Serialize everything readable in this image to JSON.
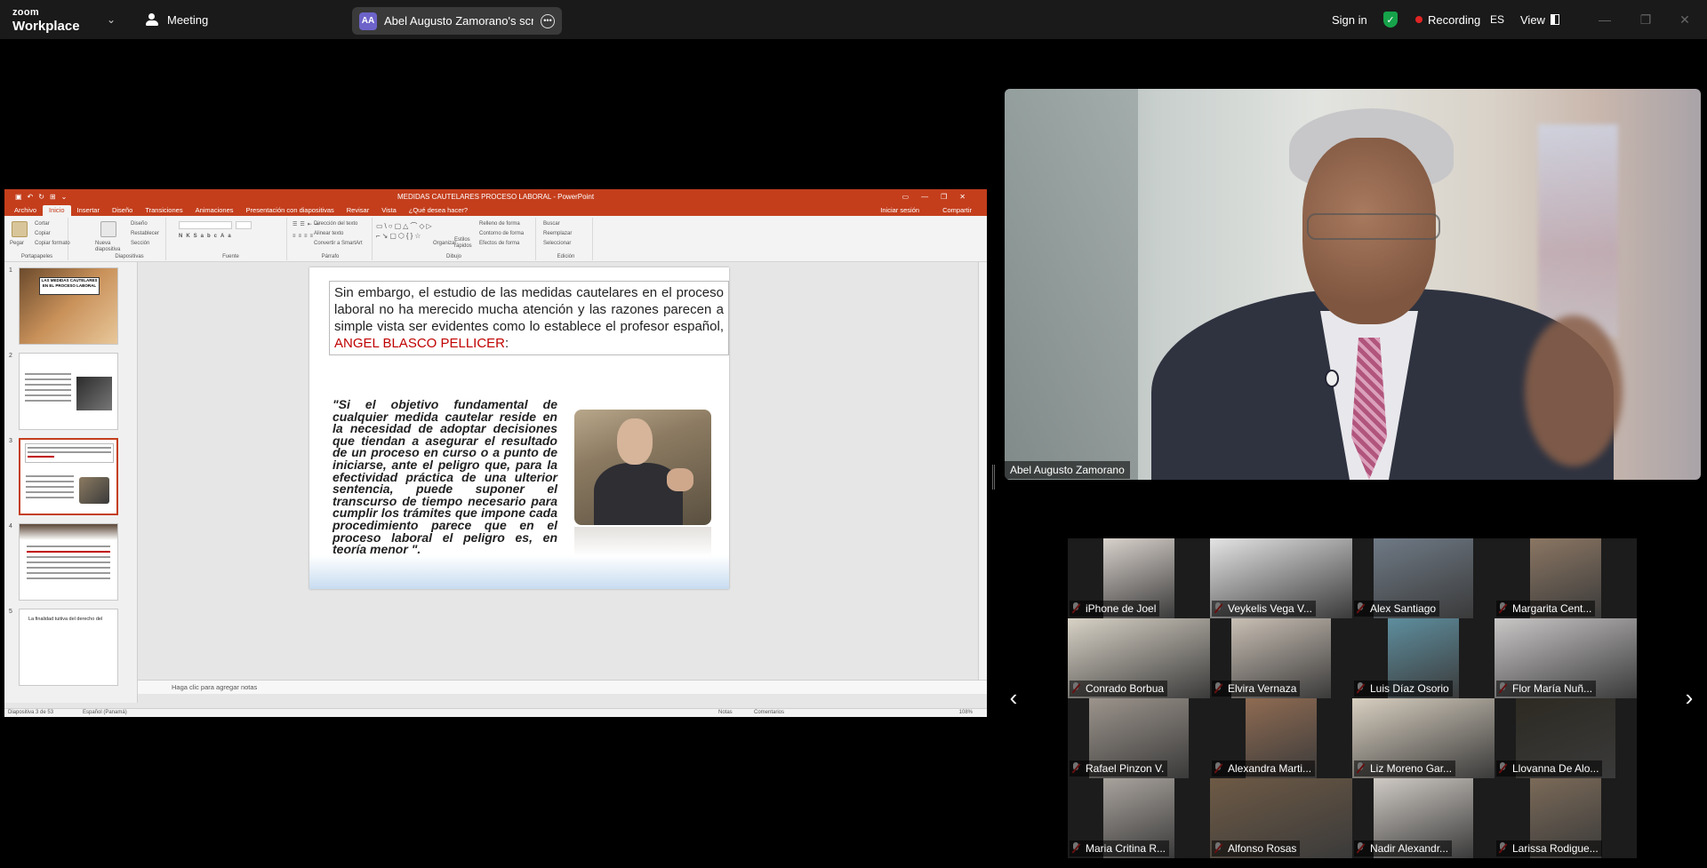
{
  "topbar": {
    "brand_small": "zoom",
    "brand_big": "Workplace",
    "meeting_label": "Meeting",
    "share_avatar": "AA",
    "share_label": "Abel Augusto Zamorano's screen",
    "signin_label": "Sign in",
    "recording_label": "Recording",
    "lang_label": "ES",
    "view_label": "View",
    "accent_recording": "#e02424",
    "accent_shield": "#16a34a"
  },
  "ppt": {
    "title": "MEDIDAS CAUTELARES PROCESO LABORAL - PowerPoint",
    "tabs": [
      "Archivo",
      "Inicio",
      "Insertar",
      "Diseño",
      "Transiciones",
      "Animaciones",
      "Presentación con diapositivas",
      "Revisar",
      "Vista",
      "¿Qué desea hacer?"
    ],
    "active_tab": "Inicio",
    "tabs_right": [
      "Iniciar sesión",
      "Compartir"
    ],
    "ribbon": {
      "portapapeles": "Portapapeles",
      "pegar": "Pegar",
      "cortar": "Cortar",
      "copiar": "Copiar",
      "copiar_formato": "Copiar formato",
      "nueva_diapositiva": "Nueva diapositiva",
      "diseno": "Diseño",
      "restablecer": "Restablecer",
      "seccion": "Sección",
      "diapositivas": "Diapositivas",
      "fuente": "Fuente",
      "parrafo": "Párrafo",
      "direccion_texto": "Dirección del texto",
      "alinear_texto": "Alinear texto",
      "convertir_smartart": "Convertir a SmartArt",
      "organizar": "Organizar",
      "estilos_rapidos": "Estilos rápidos",
      "relleno_forma": "Relleno de forma",
      "contorno_forma": "Contorno de forma",
      "efectos_forma": "Efectos de forma",
      "dibujo": "Dibujo",
      "buscar": "Buscar",
      "reemplazar": "Reemplazar",
      "seleccionar": "Seleccionar",
      "edicion": "Edición"
    },
    "thumbnails": [
      {
        "num": "1",
        "title": "LAS MEDIDAS CAUTELARES EN EL PROCESO LABORAL"
      },
      {
        "num": "2"
      },
      {
        "num": "3"
      },
      {
        "num": "4"
      },
      {
        "num": "5",
        "snippet": "La finalidad tuitiva del derecho del"
      }
    ],
    "slide": {
      "intro": "Sin embargo, el estudio de las medidas cautelares en el proceso laboral no ha merecido mucha atención y las razones parecen a simple vista ser evidentes como lo establece el profesor español, ",
      "author": "ANGEL BLASCO PELLICER",
      "colon": ":",
      "quote": "\"Si el objetivo fundamental de cualquier medida cautelar reside en la necesidad de adoptar decisiones que tiendan a asegurar el resultado de un proceso en curso o a punto de iniciarse, ante el peligro que, para la efectividad práctica de una ulterior sentencia, puede suponer el transcurso de tiempo necesario para cumplir los trámites que impone cada procedimiento parece que en el proceso laboral el peligro es, en teoría menor \".",
      "author_color": "#c00000"
    },
    "notes_placeholder": "Haga clic para agregar notas",
    "status": {
      "slide_count": "Diapositiva 3 de 53",
      "language": "Español (Panamá)",
      "notas": "Notas",
      "comentarios": "Comentarios",
      "zoom": "108%"
    }
  },
  "speaker": {
    "name": "Abel Augusto Zamorano"
  },
  "gallery": {
    "participants": [
      {
        "name": "iPhone de Joel",
        "bg": "#1c1c1c",
        "photo": "#d9d2cc"
      },
      {
        "name": "Veykelis Vega V...",
        "bg": "#1c1c1c",
        "photo": "#e4e4e4"
      },
      {
        "name": "Alex Santiago",
        "bg": "#1c1c1c",
        "photo": "#6f7a86"
      },
      {
        "name": "Margarita Cent...",
        "bg": "#1c1c1c",
        "photo": "#8b7663"
      },
      {
        "name": "Conrado Borbua",
        "bg": "#1c1c1c",
        "photo": "#d8d2c6"
      },
      {
        "name": "Elvira Vernaza",
        "bg": "#1c1c1c",
        "photo": "#c9bfb4"
      },
      {
        "name": "Luis Díaz Osorio",
        "bg": "#1c1c1c",
        "photo": "#5e8e9e"
      },
      {
        "name": "Flor María Nuñ...",
        "bg": "#1c1c1c",
        "photo": "#c9c6c6"
      },
      {
        "name": "Rafael Pinzon V.",
        "bg": "#1c1c1c",
        "photo": "#9c948c"
      },
      {
        "name": "Alexandra Marti...",
        "bg": "#1c1c1c",
        "photo": "#8f6b52"
      },
      {
        "name": "Liz Moreno Gar...",
        "bg": "#1c1c1c",
        "photo": "#d8cfc0"
      },
      {
        "name": "Llovanna De Alo...",
        "bg": "#1c1c1c",
        "photo": "#2d2a22"
      },
      {
        "name": "Maria Critina R...",
        "bg": "#1c1c1c",
        "photo": "#a9a39d"
      },
      {
        "name": "Alfonso Rosas",
        "bg": "#1c1c1c",
        "photo": "#6e5a45"
      },
      {
        "name": "Nadir Alexandr...",
        "bg": "#1c1c1c",
        "photo": "#cfcac4"
      },
      {
        "name": "Larissa Rodigue...",
        "bg": "#1c1c1c",
        "photo": "#7b6a58"
      }
    ],
    "prev_label": "‹",
    "next_label": "›"
  }
}
